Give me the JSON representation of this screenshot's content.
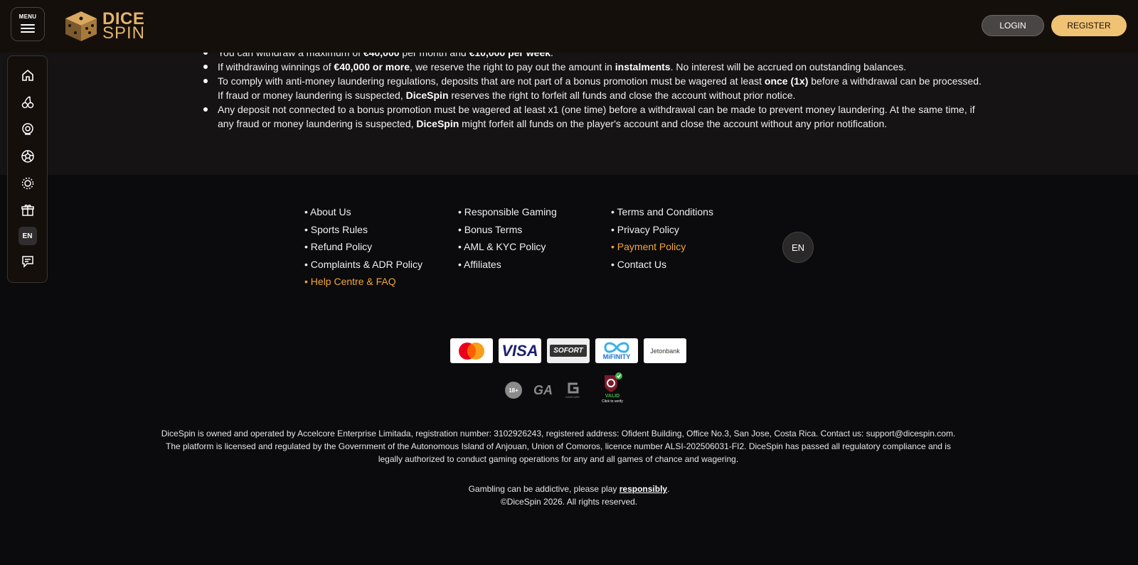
{
  "header": {
    "menu_label": "MENU",
    "logo_line1": "DICE",
    "logo_line2": "SPIN",
    "login_label": "LOGIN",
    "register_label": "REGISTER"
  },
  "sidebar": {
    "items": [
      "home-icon",
      "cherry-slots-icon",
      "live-casino-icon",
      "sports-ball-icon",
      "virtuals-icon",
      "gift-icon"
    ],
    "lang": "EN",
    "support_icon": "chat-support-icon"
  },
  "content": {
    "bullets": [
      {
        "parts": [
          {
            "t": "You can withdraw a maximum of "
          },
          {
            "t": "€40,000",
            "b": true
          },
          {
            "t": " per month and "
          },
          {
            "t": "€10,000 per week",
            "b": true
          },
          {
            "t": "."
          }
        ]
      },
      {
        "parts": [
          {
            "t": "If withdrawing winnings of "
          },
          {
            "t": "€40,000 or more",
            "b": true
          },
          {
            "t": ", we reserve the right to pay out the amount in "
          },
          {
            "t": "instalments",
            "b": true
          },
          {
            "t": ". No interest will be accrued on outstanding balances."
          }
        ]
      },
      {
        "parts": [
          {
            "t": "To comply with anti-money laundering regulations, deposits that are not part of a bonus promotion must be wagered at least "
          },
          {
            "t": "once (1x)",
            "b": true
          },
          {
            "t": " before a withdrawal can be processed. If fraud or money laundering is suspected, "
          },
          {
            "t": "DiceSpin",
            "b": true
          },
          {
            "t": " reserves the right to forfeit all funds and close the account without prior notice."
          }
        ]
      },
      {
        "parts": [
          {
            "t": "Any deposit not connected to a bonus promotion must be wagered at least x1  (one time) before a  withdrawal can be made to prevent money laundering. At the same time, if any fraud or money laundering is suspected, "
          },
          {
            "t": "DiceSpin",
            "b": true
          },
          {
            "t": " might forfeit all funds on the player's account and close the account without any prior notification."
          }
        ]
      }
    ]
  },
  "footer": {
    "col1": [
      "About Us",
      "Sports Rules",
      "Refund Policy",
      "Complaints & ADR Policy",
      "Help Centre & FAQ"
    ],
    "col2": [
      "Responsible Gaming",
      "Bonus Terms",
      "AML & KYC Policy",
      "Affiliates"
    ],
    "col3": [
      "Terms and Conditions",
      "Privacy Policy",
      "Payment Policy",
      "Contact Us"
    ],
    "lang": "EN",
    "payments": [
      "mastercard-logo",
      "VISA",
      "SOFORT",
      "MiFINITY",
      "Jetonbank"
    ],
    "badges": {
      "age": "18+",
      "ga": "GA",
      "gamcare": "GAMCARE",
      "valid": "VALID",
      "verify": "Click to verify"
    },
    "legal": "DiceSpin is owned and operated by Accelcore Enterprise Limitada, registration number: 3102926243, registered address: Ofident Building, Office No.3, San Jose, Costa Rica. Contact us: support@dicespin.com. The platform is licensed and regulated by the Government of the Autonomous Island of Anjouan, Union of Comoros, licence number ALSI-202506031-FI2. DiceSpin has passed all regulatory compliance and is legally authorized to conduct gaming operations for any and all games of chance and wagering.",
    "gamble_prefix": "Gambling can be addictive, please play ",
    "gamble_link": "responsibly",
    "gamble_suffix": ".",
    "copyright": "©DiceSpin 2026. All rights reserved."
  },
  "colors": {
    "accent": "#f0c274",
    "link_highlight": "#f0a63c",
    "header_bg": "#150f0c"
  }
}
